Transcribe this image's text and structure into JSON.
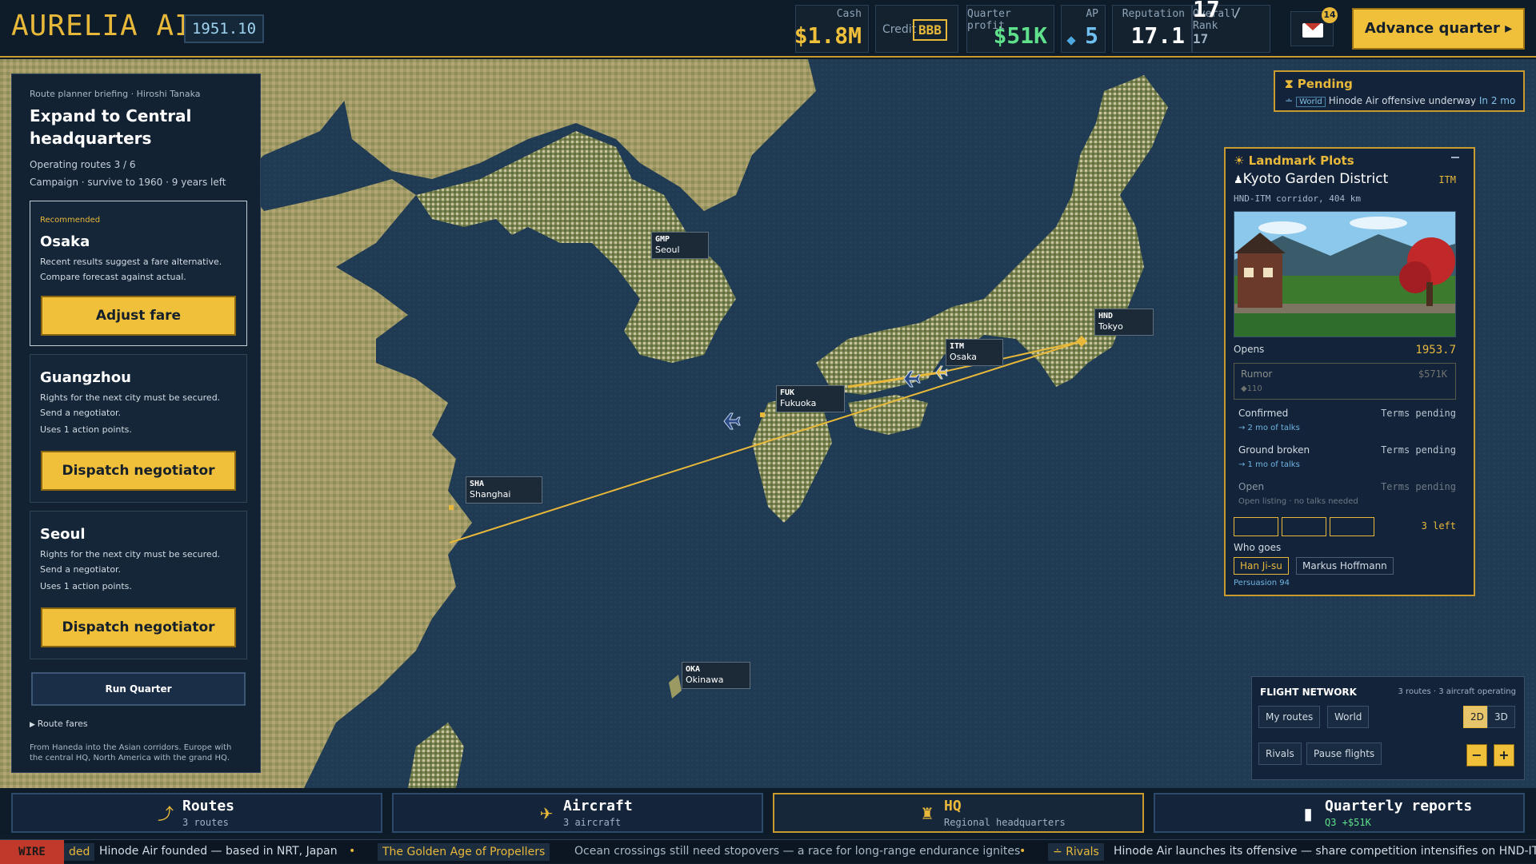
{
  "brand": {
    "name": "AURELIA AIR",
    "date": "1951.10"
  },
  "stats": {
    "cash_label": "Cash",
    "cash": "$1.8M",
    "credit_label": "Credit",
    "credit": "BBB",
    "profit_label": "Quarter profit",
    "profit": "$51K",
    "ap_label": "AP",
    "ap": "5",
    "rep_label": "Reputation",
    "rep": "17.1",
    "rank_label": "Overall Rank",
    "rank": "17",
    "rank_total": "/ 17"
  },
  "mail": {
    "count": "14"
  },
  "advance": "Advance quarter ▸",
  "left": {
    "briefing": "Route planner briefing · Hiroshi Tanaka",
    "title": "Expand to Central headquarters",
    "routes": "Operating routes 3 / 6",
    "campaign": "Campaign · survive to 1960 · 9 years left",
    "cards": [
      {
        "tag": "Recommended",
        "title": "Osaka",
        "line1": "Recent results suggest a fare alternative.",
        "line2": "Compare forecast against actual.",
        "button": "Adjust fare"
      },
      {
        "title": "Guangzhou",
        "line1": "Rights for the next city must be secured.",
        "line2": "Send a negotiator.",
        "line3": "Uses 1 action points.",
        "button": "Dispatch negotiator"
      },
      {
        "title": "Seoul",
        "line1": "Rights for the next city must be secured.",
        "line2": "Send a negotiator.",
        "line3": "Uses 1 action points.",
        "button": "Dispatch negotiator"
      }
    ],
    "run": "Run Quarter",
    "fares": "Route fares",
    "footer": "From Haneda into the Asian corridors. Europe with the central HQ, North America with the grand HQ."
  },
  "pending": {
    "title": "Pending",
    "tag": "World",
    "text": "Hinode Air offensive underway",
    "when": "In 2 mo"
  },
  "landmark": {
    "title": "Landmark Plots",
    "site": "Kyoto Garden District",
    "code": "ITM",
    "corridor": "HND-ITM corridor, 404 km",
    "opens_label": "Opens",
    "opens": "1953.7",
    "rumor_label": "Rumor",
    "rumor_val": "$571K",
    "rumor_sub": "◆110",
    "confirmed_label": "Confirmed",
    "confirmed_val": "Terms pending",
    "confirmed_sub": "→ 2 mo of talks",
    "ground_label": "Ground broken",
    "ground_val": "Terms pending",
    "ground_sub": "→ 1 mo of talks",
    "open_label": "Open",
    "open_val": "Terms pending",
    "open_sub": "Open listing · no talks needed",
    "left": "3 left",
    "who": "Who goes",
    "people": [
      "Han Ji-su",
      "Markus Hoffmann"
    ],
    "persuasion": "Persuasion 94"
  },
  "cities": [
    {
      "code": "GMP",
      "name": "Seoul"
    },
    {
      "code": "HND",
      "name": "Tokyo"
    },
    {
      "code": "ITM",
      "name": "Osaka"
    },
    {
      "code": "FUK",
      "name": "Fukuoka"
    },
    {
      "code": "SHA",
      "name": "Shanghai"
    },
    {
      "code": "OKA",
      "name": "Okinawa"
    }
  ],
  "network": {
    "title": "FLIGHT NETWORK",
    "info": "3 routes · 3 aircraft operating",
    "my": "My routes",
    "world": "World",
    "d2": "2D",
    "d3": "3D",
    "rivals": "Rivals",
    "pause": "Pause flights",
    "minus": "−",
    "plus": "+"
  },
  "tabs": [
    {
      "title": "Routes",
      "sub": "3 routes"
    },
    {
      "title": "Aircraft",
      "sub": "3 aircraft"
    },
    {
      "title": "HQ",
      "sub": "Regional headquarters"
    },
    {
      "title": "Quarterly reports",
      "sub": "Q3 +$51K"
    }
  ],
  "ticker": {
    "wire": "WIRE",
    "frag": "ded",
    "item1": "Hinode Air founded — based in NRT, Japan",
    "badge2": "The Golden Age of Propellers",
    "item2": "Ocean crossings still need stopovers — a race for long-range endurance ignites",
    "badge3": "Rivals",
    "item3": "Hinode Air launches its offensive — share competition intensifies on HND-ITM"
  },
  "colors": {
    "accent": "#e8b83a",
    "sea": "#1d3850",
    "land": "#9a9a62",
    "panel": "#132232"
  }
}
